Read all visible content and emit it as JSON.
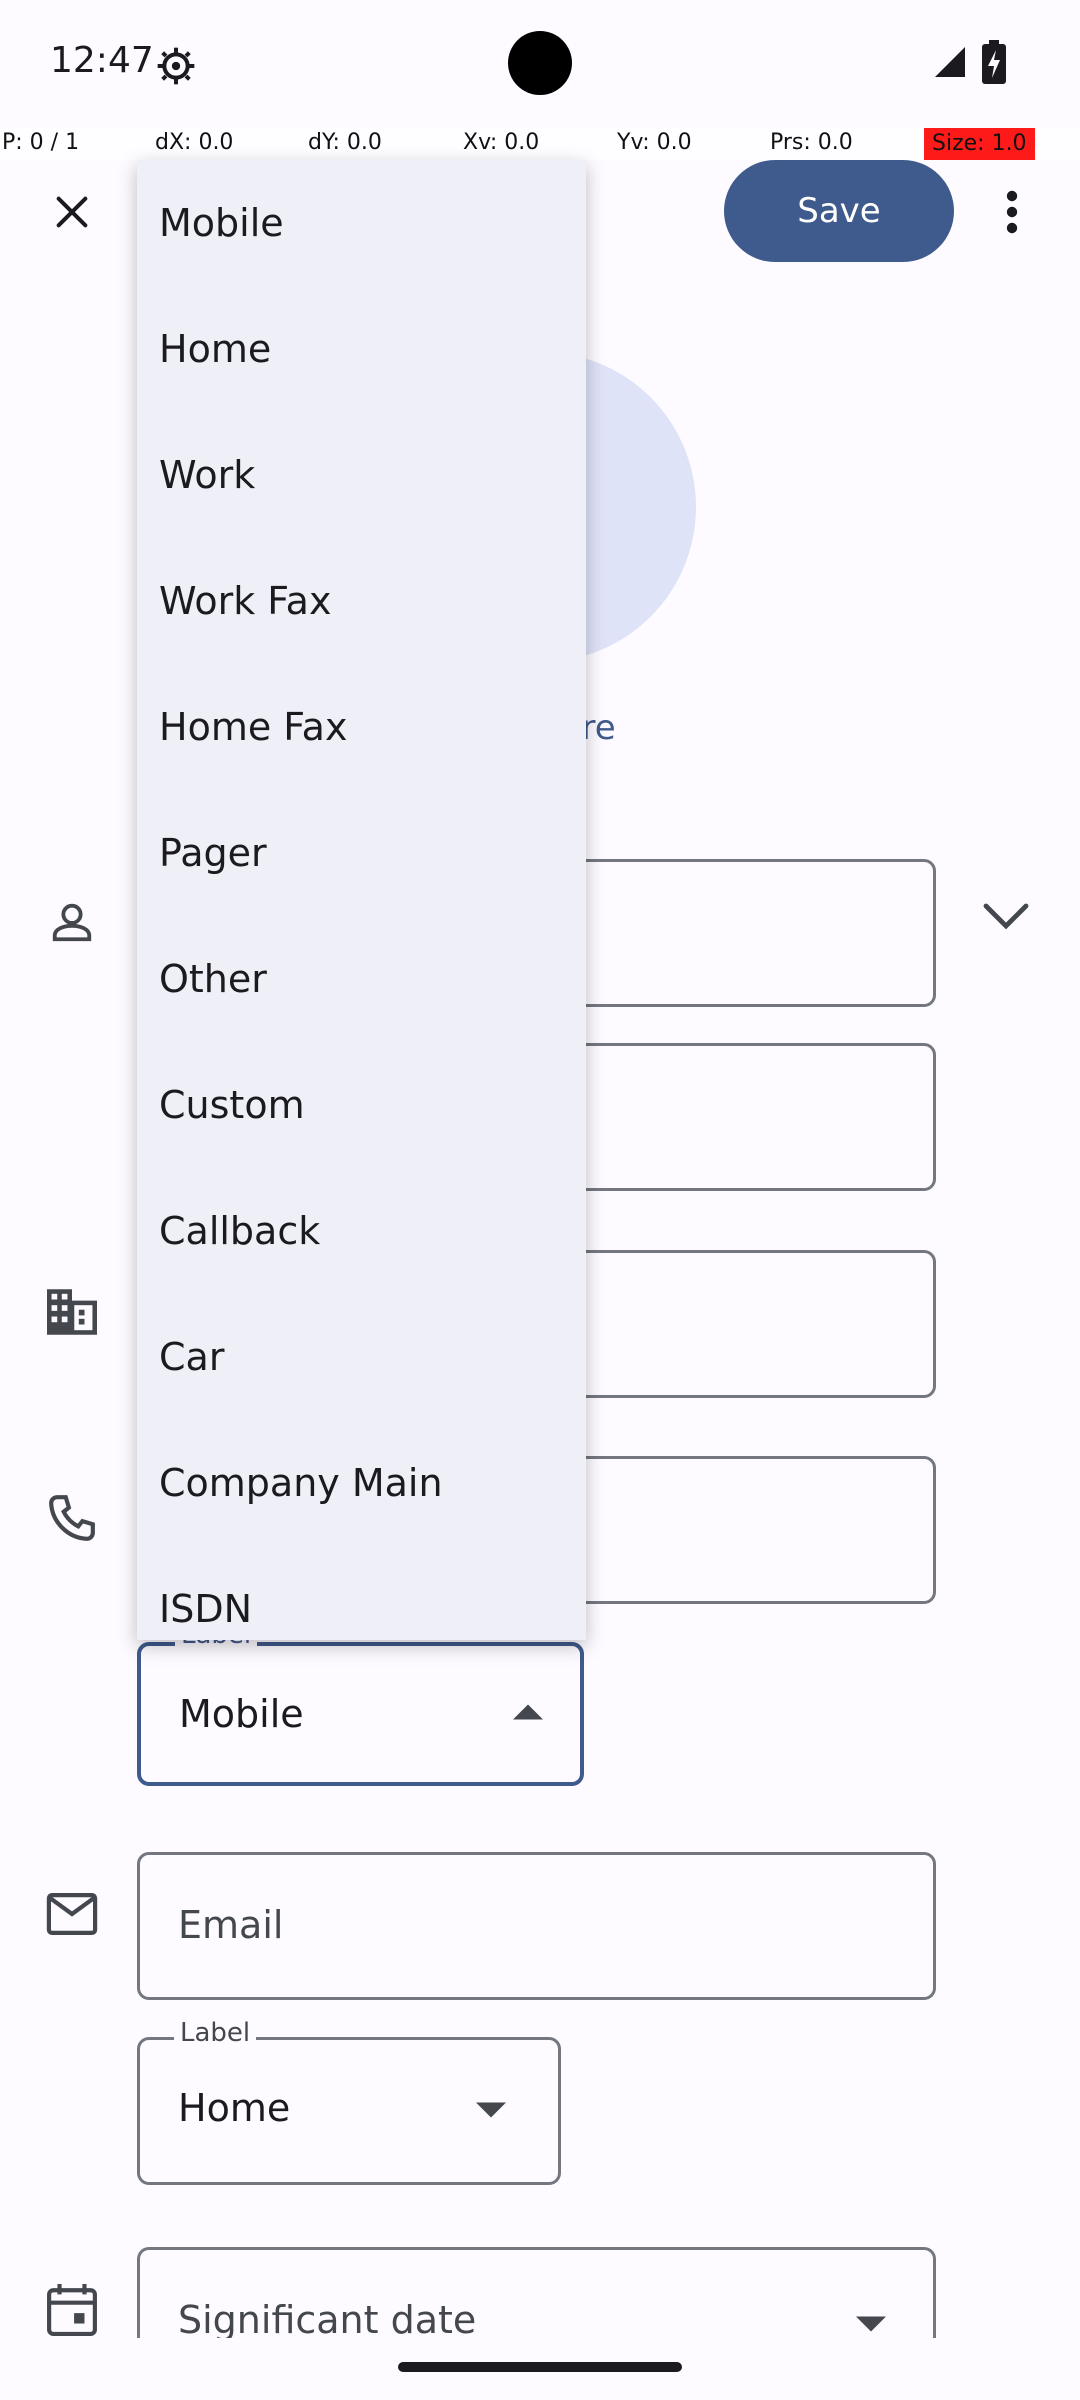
{
  "status_bar": {
    "time": "12:47",
    "icons": [
      "settings-icon",
      "signal-icon",
      "battery-icon"
    ]
  },
  "debug_bar": {
    "pointer": "P: 0 / 1",
    "dx": "dX: 0.0",
    "dy": "dY: 0.0",
    "xv": "Xv: 0.0",
    "yv": "Yv: 0.0",
    "prs": "Prs: 0.0",
    "size": "Size: 1.0"
  },
  "toolbar": {
    "save_label": "Save",
    "close_icon": "close-icon",
    "more_icon": "more-vertical-icon"
  },
  "avatar": {
    "picture_link_partial": "ure"
  },
  "phone": {
    "label_caption": "Label",
    "label_value": "Mobile"
  },
  "email": {
    "placeholder": "Email",
    "label_caption": "Label",
    "label_value": "Home"
  },
  "significant_date": {
    "placeholder": "Significant date"
  },
  "dropdown": {
    "items": [
      "Mobile",
      "Home",
      "Work",
      "Work Fax",
      "Home Fax",
      "Pager",
      "Other",
      "Custom",
      "Callback",
      "Car",
      "Company Main",
      "ISDN"
    ]
  },
  "colors": {
    "accent": "#3f5a8c",
    "avatar_bg": "#dfe3f8",
    "menu_bg": "#eff0f7",
    "outline": "#74777f"
  }
}
